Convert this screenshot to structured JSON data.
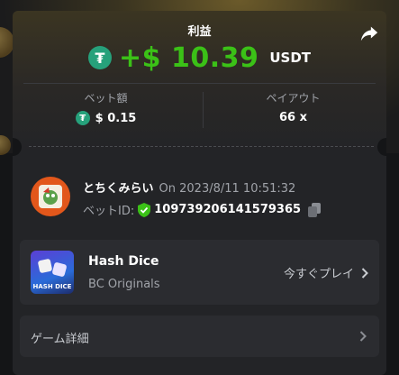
{
  "header": {
    "profit_label": "利益",
    "profit_amount": "+$ 10.39",
    "currency": "USDT",
    "currency_icon": "tether-icon",
    "accent_profit": "#3bc117"
  },
  "stats": {
    "bet_amount_label": "ベット額",
    "bet_amount_value": "$ 0.15",
    "payout_label": "ペイアウト",
    "payout_value": "66 x"
  },
  "bet": {
    "username": "とちくみらい",
    "datetime": "On 2023/8/11 10:51:32",
    "bet_id_label": "ベットID:",
    "bet_id": "109739206141579365"
  },
  "game": {
    "thumb_text": "HASH DICE",
    "name": "Hash Dice",
    "provider": "BC Originals",
    "play_label": "今すぐプレイ"
  },
  "details": {
    "label": "ゲーム詳細"
  }
}
